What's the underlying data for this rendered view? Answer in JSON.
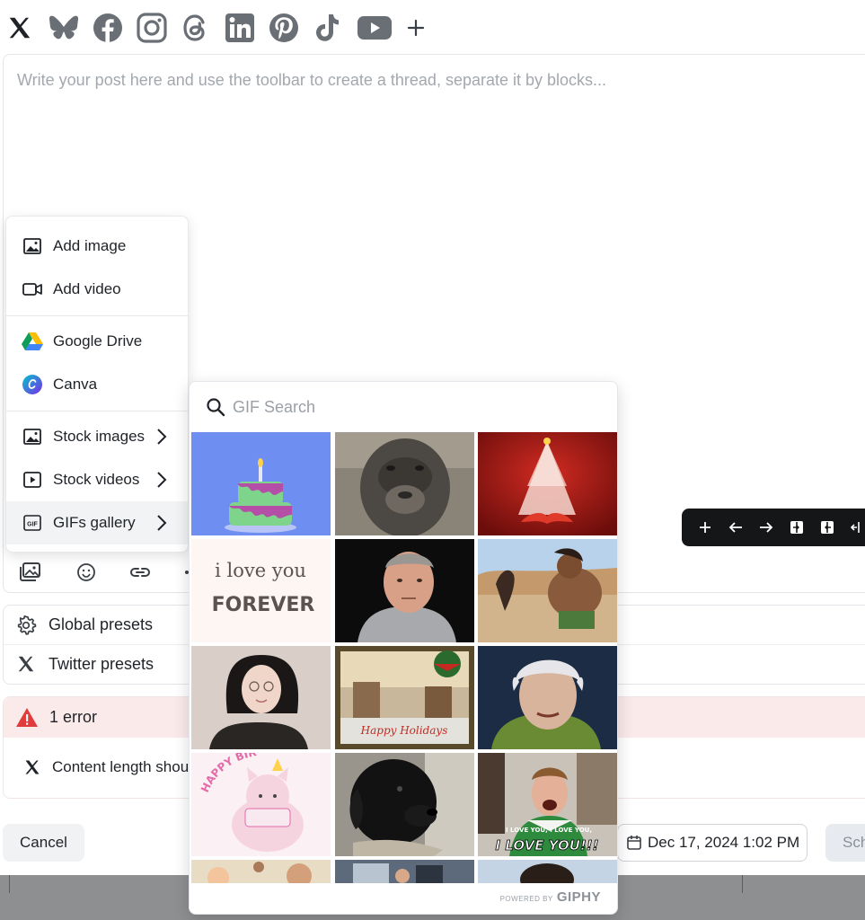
{
  "networks": [
    {
      "name": "X",
      "icon": "x-icon"
    },
    {
      "name": "Bluesky",
      "icon": "bluesky-icon"
    },
    {
      "name": "Facebook",
      "icon": "facebook-icon"
    },
    {
      "name": "Instagram",
      "icon": "instagram-icon"
    },
    {
      "name": "Threads",
      "icon": "threads-icon"
    },
    {
      "name": "LinkedIn",
      "icon": "linkedin-icon"
    },
    {
      "name": "Pinterest",
      "icon": "pinterest-icon"
    },
    {
      "name": "TikTok",
      "icon": "tiktok-icon"
    },
    {
      "name": "YouTube",
      "icon": "youtube-icon"
    },
    {
      "name": "Add network",
      "icon": "plus-icon"
    }
  ],
  "editor": {
    "placeholder": "Write your post here and use the toolbar to create a thread, separate it by blocks..."
  },
  "media_menu": {
    "add_image": "Add image",
    "add_video": "Add video",
    "google_drive": "Google Drive",
    "canva": "Canva",
    "stock_images": "Stock images",
    "stock_videos": "Stock videos",
    "gifs_gallery": "GIFs gallery"
  },
  "gif_picker": {
    "search_placeholder": "GIF Search",
    "tile_texts": {
      "love": "i love you",
      "forever": "FOREVER",
      "birthday": "HAPPY BIRTHDAY!",
      "holidays": "Happy Holidays",
      "love_small": "I LOVE YOU, I LOVE YOU,",
      "love_big": "I LOVE YOU!!!"
    },
    "powered_by": "POWERED BY",
    "brand": "GIPHY"
  },
  "presets": {
    "global": "Global presets",
    "twitter": "Twitter presets"
  },
  "errors": {
    "summary": "1 error",
    "message": "Content length shou"
  },
  "footer": {
    "cancel": "Cancel",
    "date": "Dec 17, 2024 1:02 PM",
    "schedule": "Sch"
  },
  "colors": {
    "error_bg": "#fbeaea",
    "error_icon": "#e23b3b",
    "dark_toolbar": "#141618"
  }
}
